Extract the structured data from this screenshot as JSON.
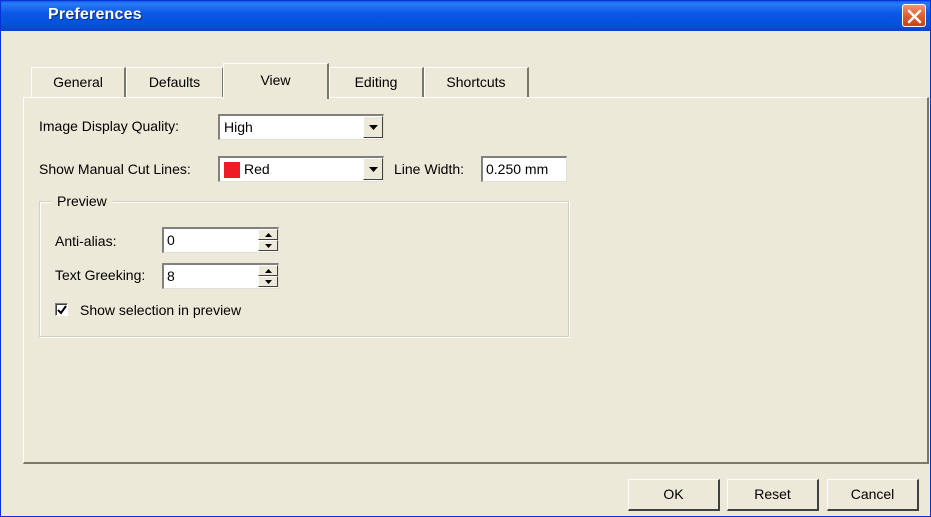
{
  "window": {
    "title": "Preferences"
  },
  "tabs": [
    {
      "label": "General"
    },
    {
      "label": "Defaults"
    },
    {
      "label": "View",
      "active": true
    },
    {
      "label": "Editing"
    },
    {
      "label": "Shortcuts"
    }
  ],
  "view": {
    "image_quality_label": "Image Display Quality:",
    "image_quality_value": "High",
    "cut_lines_label": "Show Manual Cut Lines:",
    "cut_lines_value": "Red",
    "cut_lines_color": "#ee1c25",
    "line_width_label": "Line Width:",
    "line_width_value": "0.250 mm"
  },
  "preview": {
    "title": "Preview",
    "anti_alias_label": "Anti-alias:",
    "anti_alias_value": "0",
    "text_greeking_label": "Text Greeking:",
    "text_greeking_value": "8",
    "show_selection_label": "Show selection in preview",
    "show_selection_checked": true
  },
  "buttons": {
    "ok": "OK",
    "reset": "Reset",
    "cancel": "Cancel"
  },
  "icons": {
    "close": "close-icon",
    "dropdown": "chevron-down-icon",
    "spin_up": "spin-up-icon",
    "spin_down": "spin-down-icon",
    "check": "checkmark-icon"
  }
}
